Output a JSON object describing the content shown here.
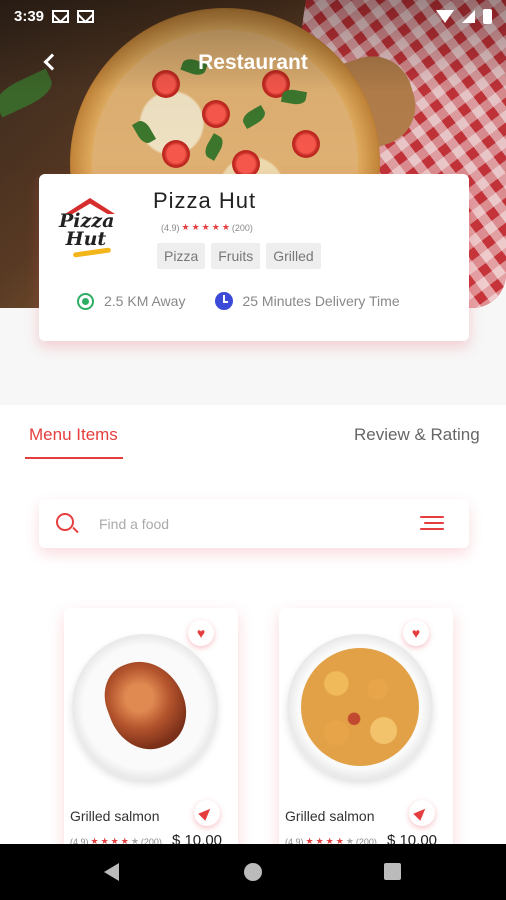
{
  "status_bar": {
    "time": "3:39"
  },
  "app_bar": {
    "title": "Restaurant"
  },
  "restaurant": {
    "name": "Pizza Hut",
    "logo_text_1": "Pizza",
    "logo_text_2": "Hut",
    "rating": "(4.9)",
    "rating_stars": 5,
    "reviews": "(200)",
    "tags": [
      "Pizza",
      "Fruits",
      "Grilled"
    ],
    "distance": "2.5 KM Away",
    "delivery_time": "25 Minutes Delivery Time"
  },
  "tabs": {
    "menu_items": "Menu Items",
    "review_rating": "Review & Rating"
  },
  "search": {
    "placeholder": "Find a food",
    "value": ""
  },
  "food_items": [
    {
      "name": "Grilled salmon",
      "rating": "(4.9)",
      "reviews": "(200)",
      "price": "$ 10.00"
    },
    {
      "name": "Grilled salmon",
      "rating": "(4.9)",
      "reviews": "(200)",
      "price": "$ 10.00"
    }
  ],
  "icons": {
    "back": "chevron-left-icon",
    "location": "location-target-icon",
    "clock": "clock-icon",
    "search": "search-icon",
    "filter": "filter-lines-icon",
    "favorite": "heart-icon",
    "navigate": "navigation-arrow-icon"
  },
  "colors": {
    "accent": "#e53e3e",
    "location": "#2eae62",
    "clock": "#3b4bd8"
  }
}
